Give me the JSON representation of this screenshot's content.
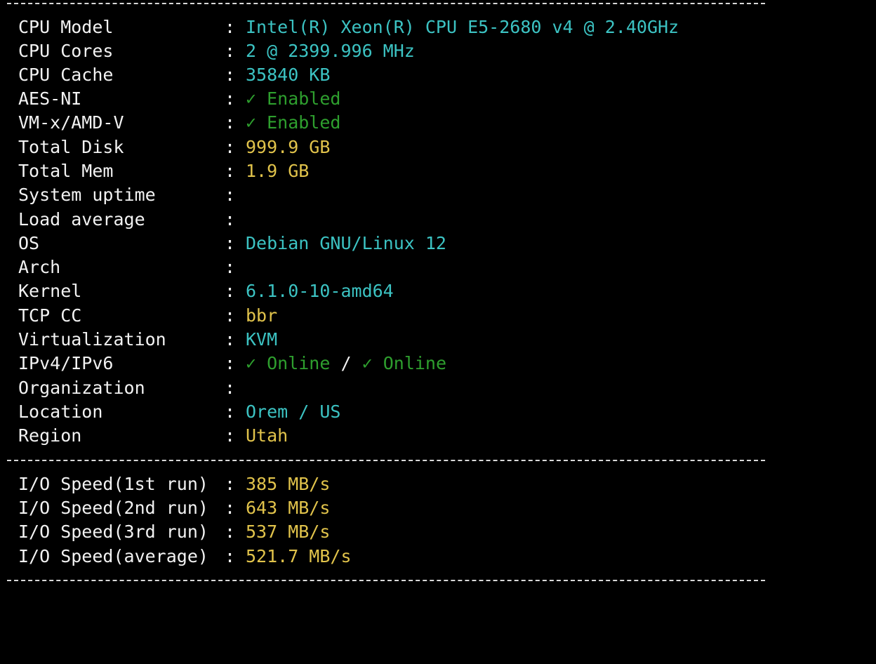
{
  "colors": {
    "background": "#000000",
    "label": "#f2f2f2",
    "cyan": "#3cc3c3",
    "yellow": "#e1c34b",
    "green": "#2e9f2e"
  },
  "colon": ":",
  "system_info": {
    "cpu_model": {
      "label": "CPU Model",
      "value": "Intel(R) Xeon(R) CPU E5-2680 v4 @ 2.40GHz"
    },
    "cpu_cores": {
      "label": "CPU Cores",
      "value": "2 @ 2399.996 MHz"
    },
    "cpu_cache": {
      "label": "CPU Cache",
      "value": "35840 KB"
    },
    "aes_ni": {
      "label": "AES-NI",
      "value": "✓ Enabled"
    },
    "vm_x": {
      "label": "VM-x/AMD-V",
      "value": "✓ Enabled"
    },
    "total_disk": {
      "label": "Total Disk",
      "value": "999.9 GB"
    },
    "total_mem": {
      "label": "Total Mem",
      "value": "1.9 GB"
    },
    "uptime": {
      "label": "System uptime",
      "value": ""
    },
    "load_average": {
      "label": "Load average",
      "value": ""
    },
    "os": {
      "label": "OS",
      "value": "Debian GNU/Linux 12"
    },
    "arch": {
      "label": "Arch",
      "value": ""
    },
    "kernel": {
      "label": "Kernel",
      "value": "6.1.0-10-amd64"
    },
    "tcp_cc": {
      "label": "TCP CC",
      "value": "bbr"
    },
    "virtualization": {
      "label": "Virtualization",
      "value": "KVM"
    },
    "ip": {
      "label": "IPv4/IPv6",
      "ipv4": "✓ Online",
      "divider": "/",
      "ipv6": "✓ Online"
    },
    "organization": {
      "label": "Organization",
      "value": ""
    },
    "location": {
      "label": "Location",
      "value": "Orem / US"
    },
    "region": {
      "label": "Region",
      "value": "Utah"
    }
  },
  "io": {
    "run1": {
      "label": "I/O Speed(1st run)",
      "value": "385 MB/s"
    },
    "run2": {
      "label": "I/O Speed(2nd run)",
      "value": "643 MB/s"
    },
    "run3": {
      "label": "I/O Speed(3rd run)",
      "value": "537 MB/s"
    },
    "average": {
      "label": "I/O Speed(average)",
      "value": "521.7 MB/s"
    }
  }
}
